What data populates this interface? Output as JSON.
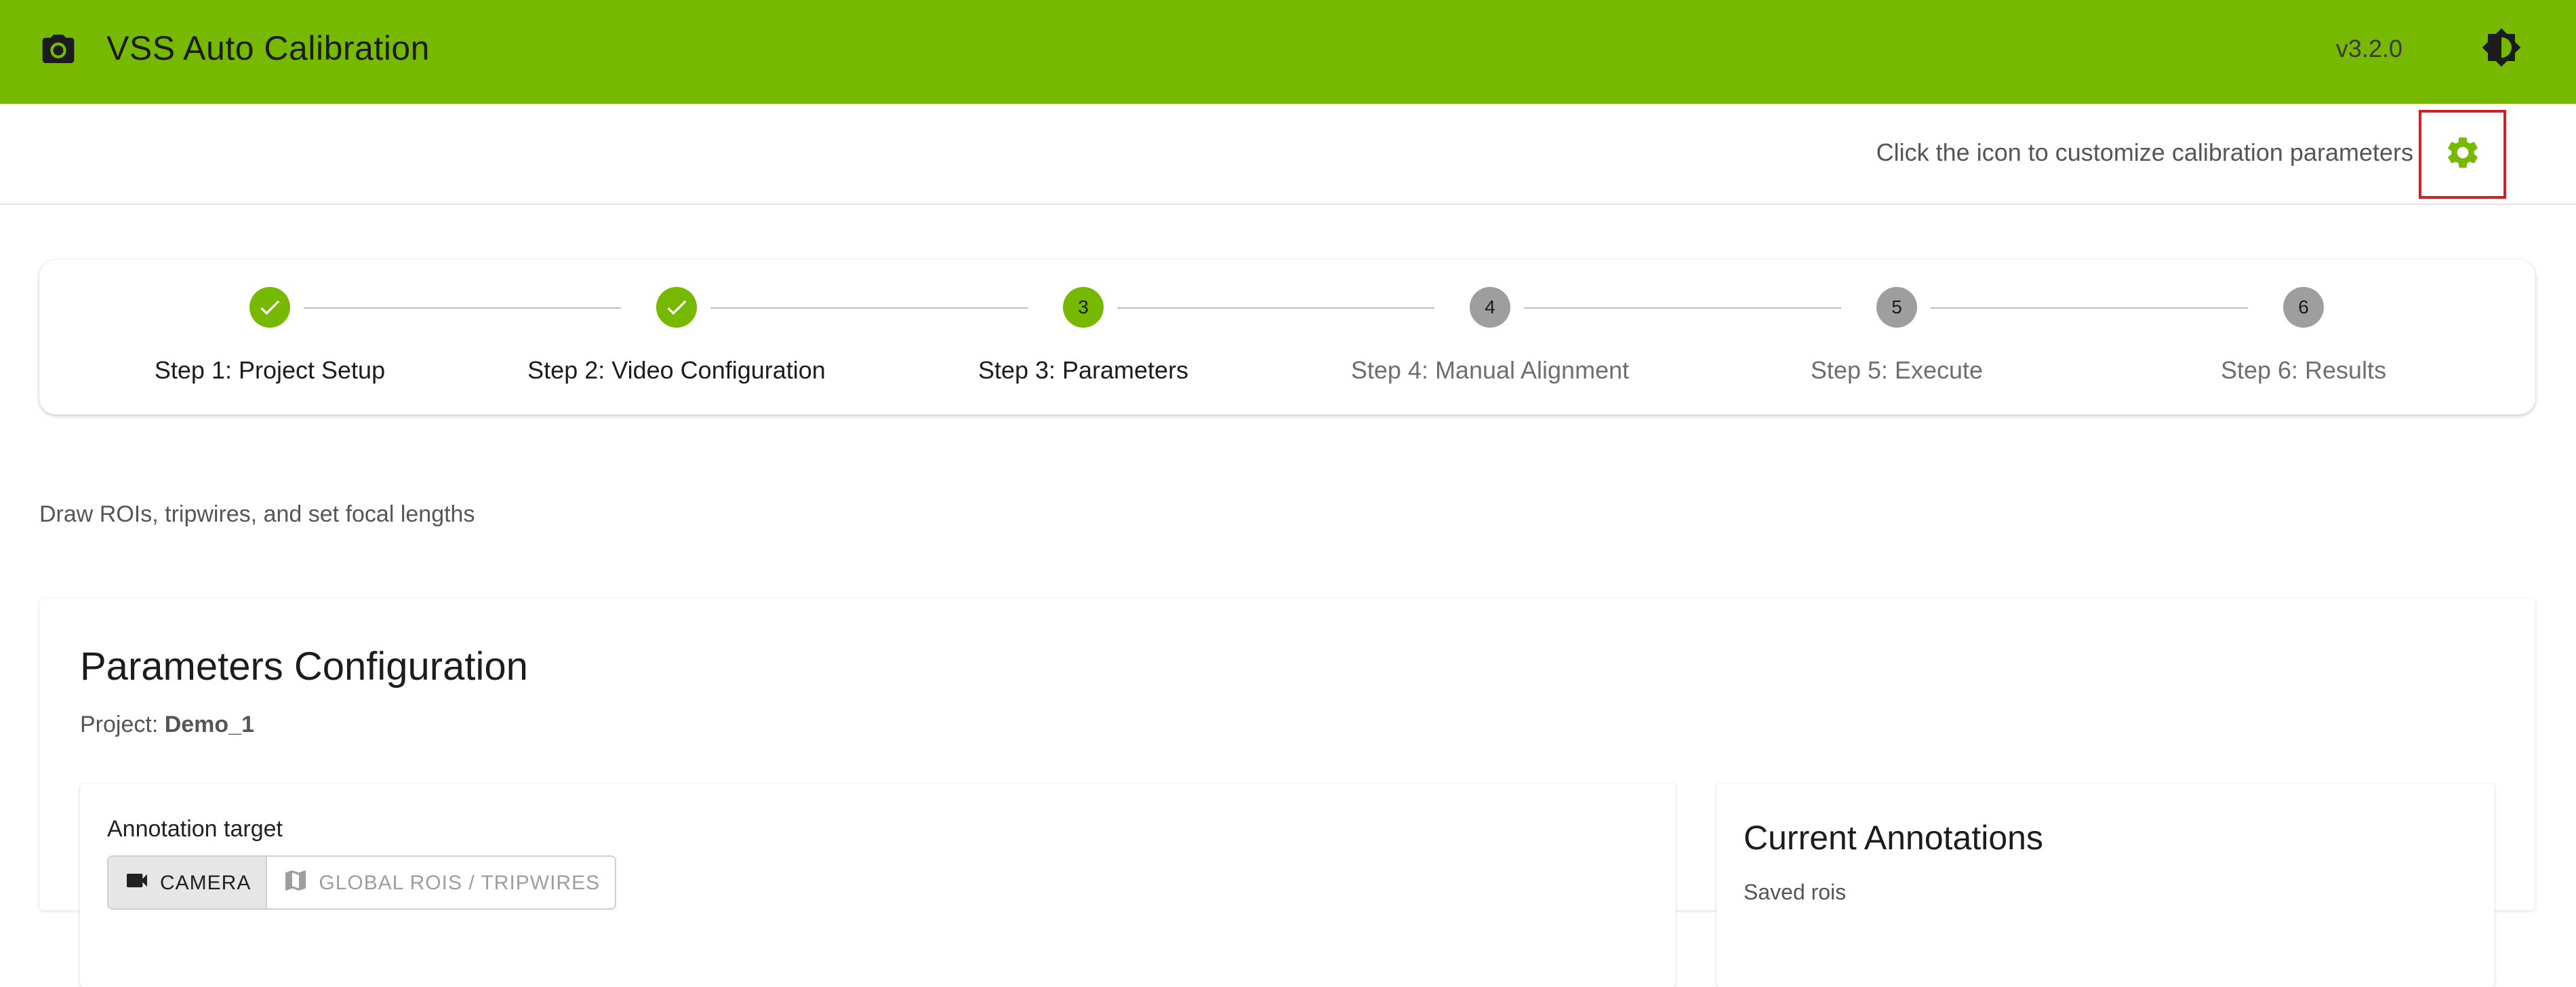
{
  "app": {
    "title": "VSS Auto Calibration",
    "version": "v3.2.0",
    "accent_color": "#76b900",
    "icons": {
      "camera": "camera-icon",
      "theme": "brightness-contrast-icon"
    }
  },
  "info_bar": {
    "hint": "Click the icon to customize calibration parameters",
    "settings_icon": "gear-icon"
  },
  "stepper": {
    "steps": [
      {
        "number": "1",
        "label": "Step 1: Project Setup",
        "status": "completed"
      },
      {
        "number": "2",
        "label": "Step 2: Video Configuration",
        "status": "completed"
      },
      {
        "number": "3",
        "label": "Step 3: Parameters",
        "status": "active"
      },
      {
        "number": "4",
        "label": "Step 4: Manual Alignment",
        "status": "pending"
      },
      {
        "number": "5",
        "label": "Step 5: Execute",
        "status": "pending"
      },
      {
        "number": "6",
        "label": "Step 6: Results",
        "status": "pending"
      }
    ]
  },
  "page": {
    "subtitle": "Draw ROIs, tripwires, and set focal lengths",
    "card_title": "Parameters Configuration",
    "project_label": "Project:",
    "project_name": "Demo_1"
  },
  "annotation": {
    "target_label": "Annotation target",
    "options": [
      {
        "label": "CAMERA",
        "icon": "video-camera-icon",
        "selected": true
      },
      {
        "label": "GLOBAL ROIS / TRIPWIRES",
        "icon": "map-icon",
        "selected": false
      }
    ]
  },
  "current_annotations": {
    "title": "Current Annotations",
    "subtitle": "Saved rois"
  }
}
